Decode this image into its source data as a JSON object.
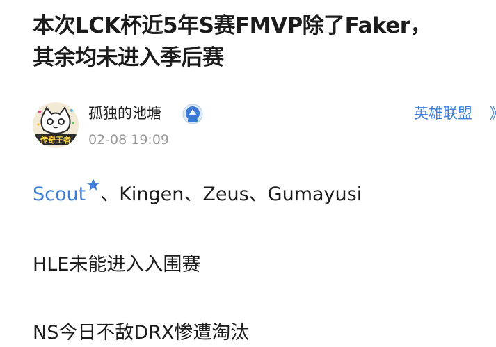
{
  "post": {
    "title_line1": "本次LCK杯近5年S赛FMVP除了Faker，",
    "title_line2": "其余均未进入季后赛"
  },
  "author": {
    "name": "孤独的池塘",
    "time": "02-08 19:09",
    "avatar_icon": "avatar-cat-icon",
    "avatar_caption": "传奇王者",
    "badge_icon": "verified-badge-icon"
  },
  "topic": {
    "label": "英雄联盟",
    "more": "》"
  },
  "body": {
    "line1_mention": "Scout",
    "line1_rest": "、Kingen、Zeus、Gumayusi",
    "line2": "HLE未能进入入围赛",
    "line3": "NS今日不敌DRX惨遭淘汰"
  },
  "colors": {
    "link": "#3f7fd8",
    "meta": "#9a9a9a",
    "text": "#1c1c1c"
  }
}
